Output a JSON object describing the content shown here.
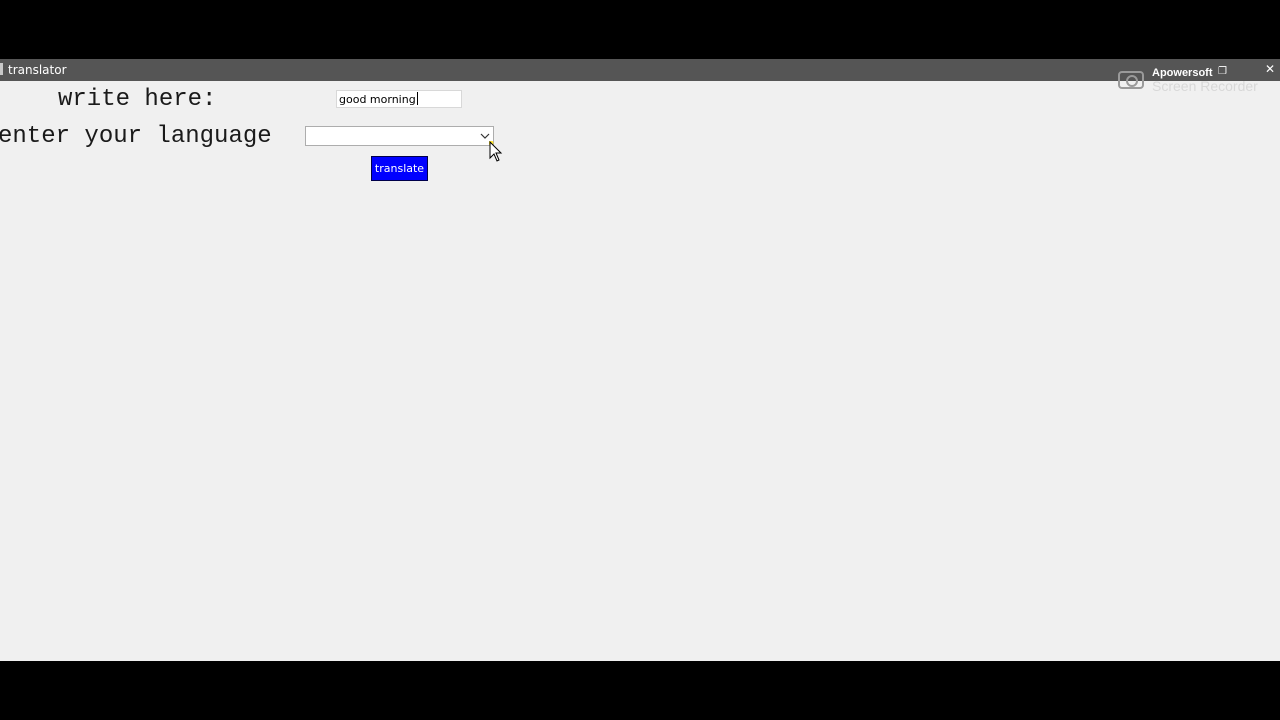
{
  "window": {
    "title": "translator",
    "close_glyph": "✕"
  },
  "watermark": {
    "brand": "Apowersoft",
    "product": "Screen Recorder",
    "restore_glyph": "❐"
  },
  "form": {
    "write_label": "write here:",
    "text_value": "good morning",
    "language_label": "enter your language",
    "language_selected": "",
    "translate_label": "translate"
  },
  "colors": {
    "button_bg": "#0000ff",
    "window_bg": "#f0f0f0",
    "titlebar_bg": "#555555"
  },
  "icons": {
    "dropdown": "chevron-down-icon",
    "cursor": "mouse-pointer-icon",
    "recorder": "camera-icon"
  }
}
